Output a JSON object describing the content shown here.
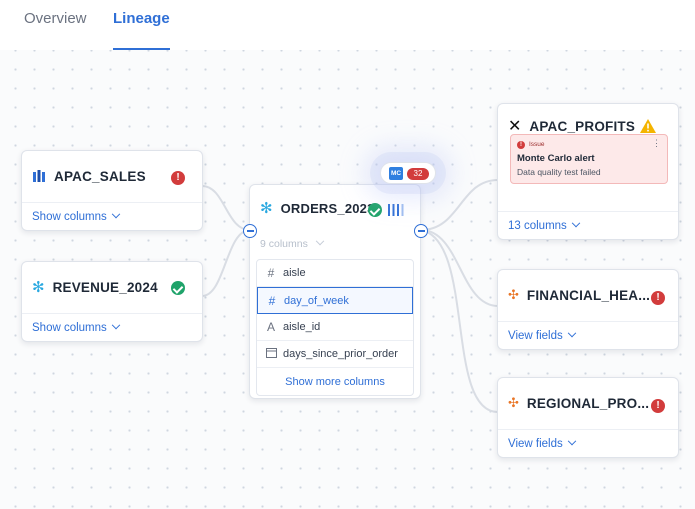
{
  "tabs": [
    {
      "label": "Overview",
      "active": false
    },
    {
      "label": "Lineage",
      "active": true
    }
  ],
  "colors": {
    "accent": "#2f6fd6",
    "error": "#d23c3c",
    "success": "#1fa36a",
    "warning": "#f4b400"
  },
  "mc_badge": {
    "label": "MC",
    "count": "32"
  },
  "nodes": {
    "apac_sales": {
      "title": "APAC_SALES",
      "icon": "bar-chart-icon",
      "status": "error",
      "footer": "Show columns"
    },
    "revenue_2024": {
      "title": "REVENUE_2024",
      "icon": "snowflake-icon",
      "status": "ok",
      "footer": "Show columns"
    },
    "orders_2023": {
      "title": "ORDERS_2023",
      "icon": "snowflake-icon",
      "status": "ok",
      "columns_count": "9 columns",
      "columns": [
        {
          "name": "aisle",
          "type_icon": "hash-icon"
        },
        {
          "name": "day_of_week",
          "type_icon": "hash-icon",
          "selected": true
        },
        {
          "name": "aisle_id",
          "type_icon": "text-type-icon"
        },
        {
          "name": "days_since_prior_order",
          "type_icon": "calendar-icon"
        }
      ],
      "show_more": "Show more columns"
    },
    "apac_profits": {
      "title": "APAC_PROFITS",
      "icon": "dbt-icon",
      "status": "warning",
      "alert": {
        "tag": "Issue",
        "title": "Monte Carlo alert",
        "message": "Data quality test failed"
      },
      "footer": "13 columns"
    },
    "financial_health": {
      "title": "FINANCIAL_HEA...",
      "icon": "tableau-icon",
      "status": "error",
      "footer": "View fields"
    },
    "regional_pro": {
      "title": "REGIONAL_PRO...",
      "icon": "tableau-icon",
      "status": "error",
      "footer": "View fields"
    }
  }
}
